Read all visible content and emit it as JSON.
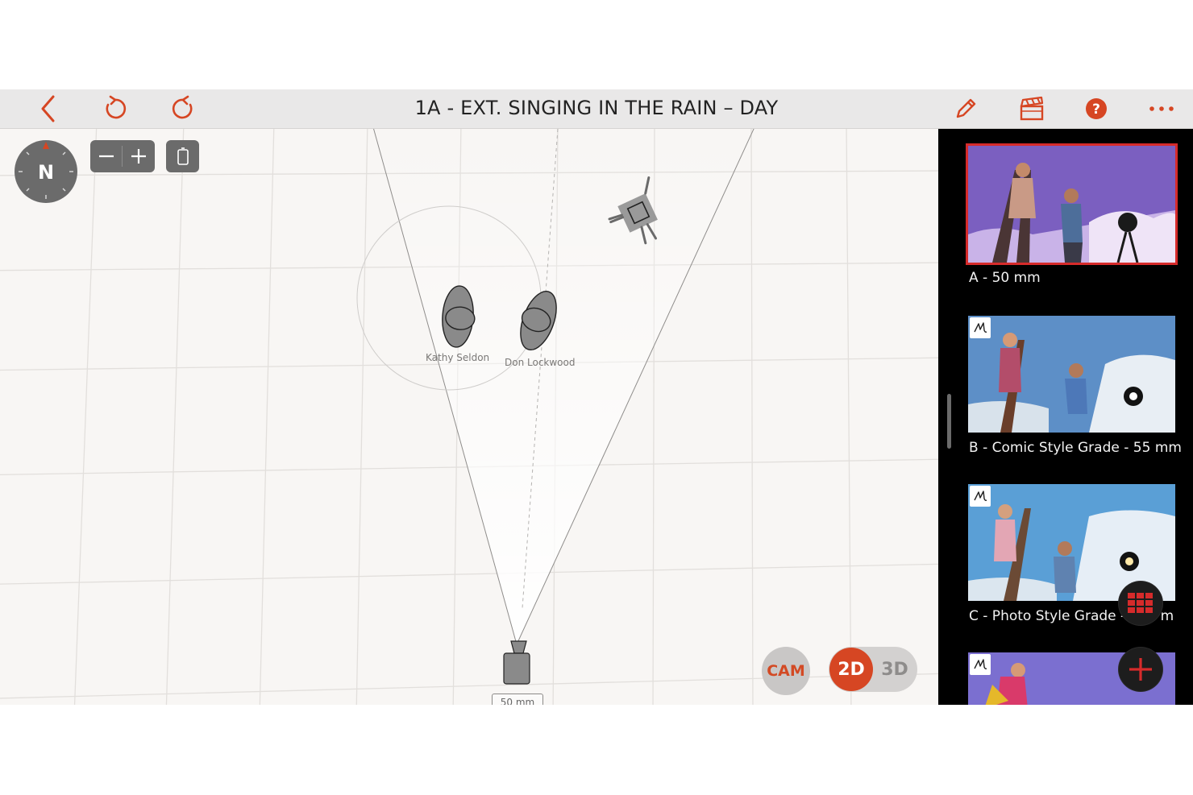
{
  "toolbar": {
    "title": "1A - EXT. SINGING IN THE RAIN – DAY",
    "accent": "#d64623"
  },
  "compass": {
    "label": "N"
  },
  "scene": {
    "actors": [
      {
        "name": "Kathy Seldon"
      },
      {
        "name": "Don Lockwood"
      }
    ],
    "camera_lens": "50 mm"
  },
  "view_controls": {
    "cam": "CAM",
    "mode_2d": "2D",
    "mode_3d": "3D",
    "active_mode": "2D"
  },
  "shots": [
    {
      "caption": "A - 50 mm",
      "selected": true,
      "has_sketch": false
    },
    {
      "caption": "B - Comic Style Grade - 55 mm",
      "selected": false,
      "has_sketch": true
    },
    {
      "caption": "C - Photo Style Grade - ",
      "caption_tail": "m",
      "selected": false,
      "has_sketch": true
    },
    {
      "caption": "",
      "selected": false,
      "has_sketch": true
    }
  ],
  "icons": {
    "back": "chevron-left-icon",
    "undo": "undo-icon",
    "redo": "redo-icon",
    "edit": "pencil-icon",
    "clapper": "clapperboard-icon",
    "help": "help-icon",
    "more": "more-icon"
  },
  "colors": {
    "selected_border": "#d62b2b",
    "panel_bg": "#000000",
    "grid_bg": "#f8f6f4"
  }
}
